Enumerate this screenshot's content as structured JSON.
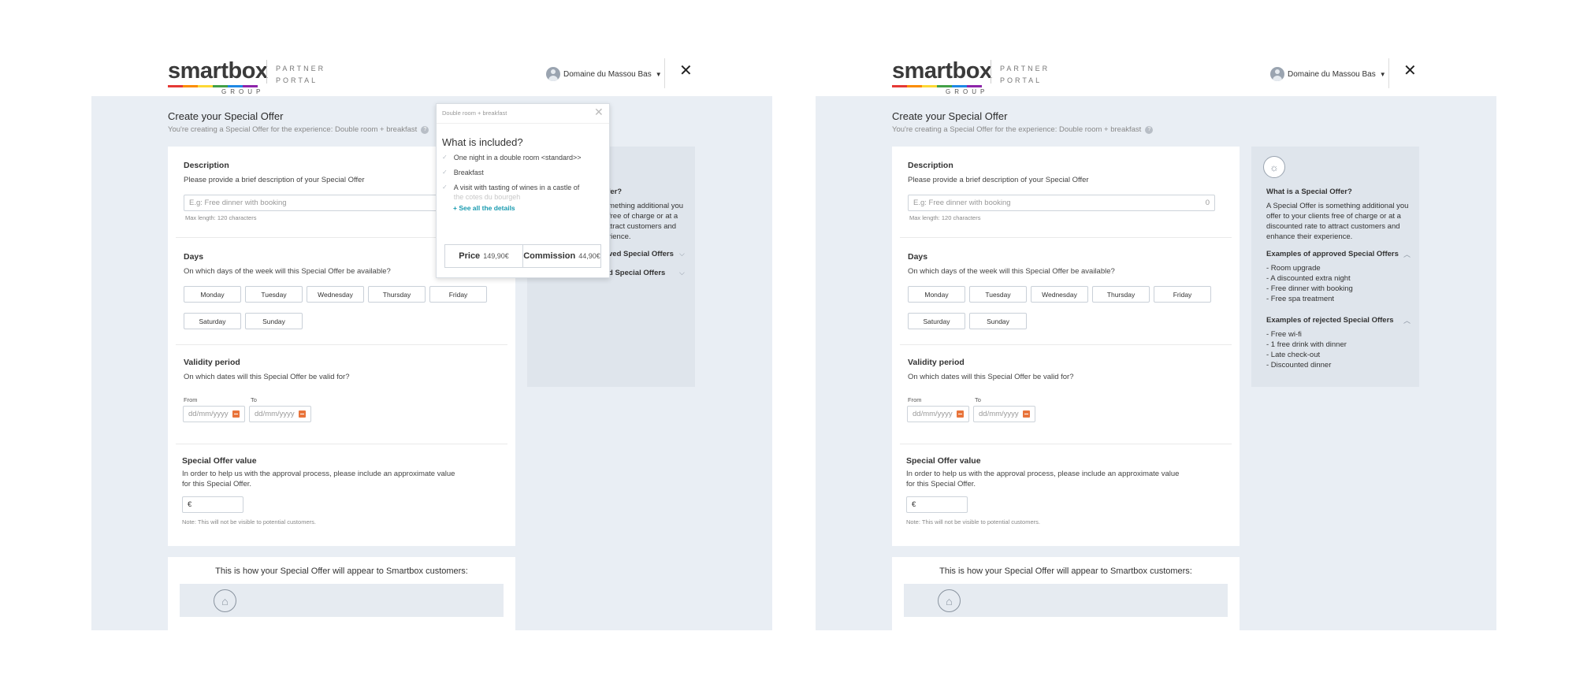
{
  "brand": {
    "logo_text": "smartbox",
    "logo_group": "GROUP",
    "portal_line1": "PARTNER",
    "portal_line2": "PORTAL",
    "bar_colors": [
      "#e53935",
      "#fb8c00",
      "#fdd835",
      "#43a047",
      "#1e88e5",
      "#8e24aa"
    ]
  },
  "header": {
    "user_name": "Domaine du Massou Bas",
    "close_glyph": "✕"
  },
  "page": {
    "title": "Create your Special Offer",
    "subtitle": "You're creating a Special Offer for the experience: Double room + breakfast",
    "help_glyph": "?"
  },
  "form": {
    "description": {
      "title": "Description",
      "text": "Please provide a brief description of your Special Offer",
      "placeholder": "E.g: Free dinner with booking",
      "counter": "0",
      "hint": "Max length: 120 characters"
    },
    "days": {
      "title": "Days",
      "text": "On which days of the week will this Special Offer be available?",
      "items": [
        "Monday",
        "Tuesday",
        "Wednesday",
        "Thursday",
        "Friday",
        "Saturday",
        "Sunday"
      ]
    },
    "validity": {
      "title": "Validity period",
      "text": "On which dates will this Special Offer be valid for?",
      "from_label": "From",
      "to_label": "To",
      "from_placeholder": "dd/mm/yyyy",
      "to_placeholder": "dd/mm/yyyy"
    },
    "value": {
      "title": "Special Offer value",
      "text_line1": "In order to help us with the approval process, please include an approximate value",
      "text_line2": "for this Special Offer.",
      "currency": "€",
      "note": "Note: This will not be visible to potential customers."
    }
  },
  "preview": {
    "title": "This is how your Special Offer will appear to Smartbox customers:"
  },
  "info": {
    "what_title": "What is a Special Offer?",
    "what_lines": [
      "A Special Offer is something additional you",
      "offer to your clients free of charge or at a",
      "discounted rate to attract customers and",
      "enhance their experience."
    ],
    "approved_title": "Examples of approved Special Offers",
    "approved_items": [
      "- Room upgrade",
      "- A discounted extra night",
      "- Free dinner with booking",
      "- Free spa treatment"
    ],
    "rejected_title": "Examples of rejected Special Offers",
    "rejected_items": [
      "- Free wi-fi",
      "- 1 free drink with dinner",
      "- Late check-out",
      "- Discounted dinner"
    ],
    "left_partial": {
      "what_title": "ffer?",
      "what_lines": [
        "mething additional you",
        "free of charge or at a",
        "ttract customers and",
        "rience."
      ],
      "approved_title": "ved Special Offers",
      "rejected_title": "d Special Offers"
    }
  },
  "popup": {
    "header": "Double room + breakfast",
    "title": "What is included?",
    "items": [
      "One night in a double room <standard>>",
      "Breakfast",
      "A visit with tasting of wines in a castle of",
      "the cotes du bourgeh"
    ],
    "link": "+ See all the details",
    "price_label": "Price",
    "price_value": "149,90€",
    "commission_label": "Commission",
    "commission_value": "44,90€"
  }
}
